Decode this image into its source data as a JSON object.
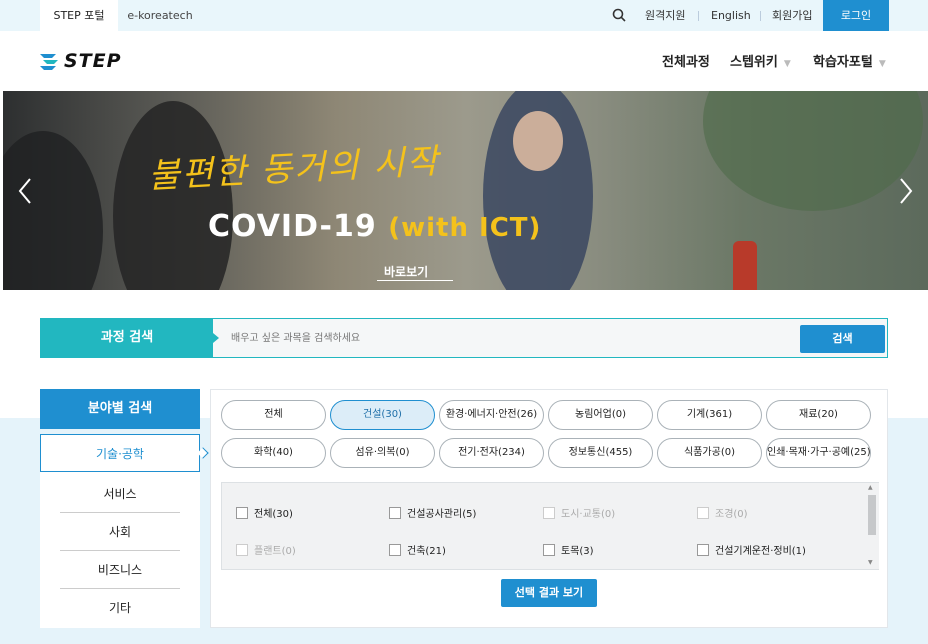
{
  "topbar": {
    "tabs": [
      "STEP 포털",
      "e-koreatech"
    ],
    "links": [
      "원격지원",
      "English",
      "회원가입"
    ],
    "login": "로그인"
  },
  "header": {
    "logo": "STEP",
    "nav": [
      "전체과정",
      "스텝위키",
      "학습자포털"
    ]
  },
  "banner": {
    "title": "불편한 동거의 시작",
    "subtitle_main": "COVID-19",
    "subtitle_accent": "(with ICT)",
    "more": "바로보기"
  },
  "search": {
    "label": "과정 검색",
    "placeholder": "배우고 싶은 과목을 검색하세요",
    "button": "검색"
  },
  "field": {
    "title": "분야별 검색",
    "side_items": [
      "기술·공학",
      "서비스",
      "사회",
      "비즈니스",
      "기타"
    ],
    "pills": [
      "전체",
      "건설(30)",
      "환경·에너지·안전(26)",
      "농림어업(0)",
      "기계(361)",
      "재료(20)",
      "화학(40)",
      "섬유·의복(0)",
      "전기·전자(234)",
      "정보통신(455)",
      "식품가공(0)",
      "인쇄·목재·가구·공예(25)"
    ],
    "checkboxes": [
      "전체(30)",
      "건설공사관리(5)",
      "도시·교통(0)",
      "조경(0)",
      "플랜트(0)",
      "건축(21)",
      "토목(3)",
      "건설기계운전·정비(1)"
    ],
    "result_button": "선택 결과 보기"
  },
  "colors": {
    "primary": "#1f8fd0",
    "teal": "#22b7c0",
    "banner_yellow": "#f4c21b"
  }
}
